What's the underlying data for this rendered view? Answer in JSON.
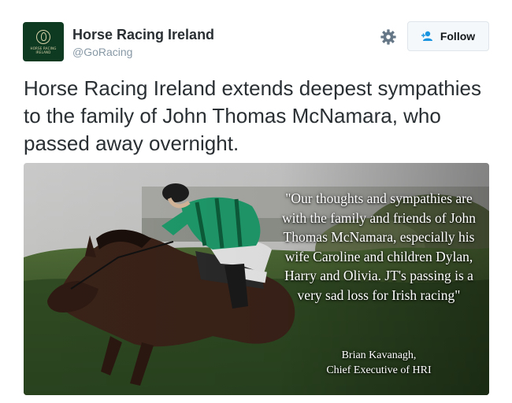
{
  "account": {
    "display_name": "Horse Racing Ireland",
    "handle": "@GoRacing",
    "avatar_text": [
      "HORSE RACING",
      "IRELAND"
    ]
  },
  "actions": {
    "settings_icon": "gear-icon",
    "follow_label": "Follow",
    "follow_icon": "add-user-icon"
  },
  "tweet": {
    "text": "Horse Racing Ireland extends deepest sympathies to the family of John Thomas McNamara, who passed away overnight."
  },
  "media": {
    "quote": "\"Our thoughts and sympathies are with the family and friends of John Thomas McNamara, especially his wife Caroline and children Dylan, Harry and Olivia. JT's passing is a very sad loss for Irish racing\"",
    "attribution_name": "Brian Kavanagh,",
    "attribution_title": "Chief Executive of HRI"
  },
  "colors": {
    "brand_dark_green": "#0f3a22",
    "handle_gray": "#8899a6",
    "text": "#292f33",
    "button_bg": "#f5f8fa",
    "jockey_silks_green": "#1f9a6a"
  }
}
